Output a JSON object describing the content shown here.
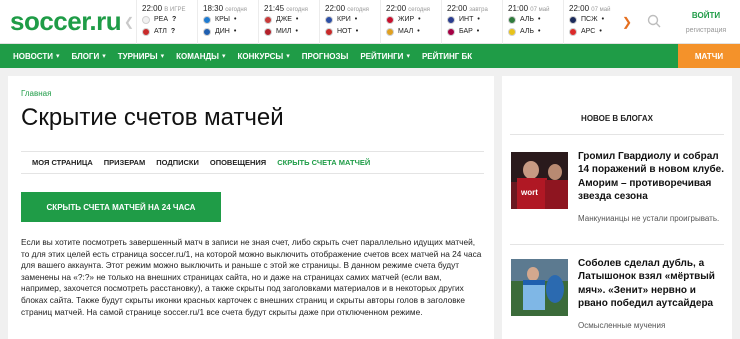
{
  "header": {
    "logo": "soccer.ru",
    "login_label": "ВОЙТИ",
    "register_label": "регистрация"
  },
  "matches": [
    {
      "time": "22:00",
      "day": "В ИГРЕ",
      "home": "РЕА",
      "home_score": "?",
      "away": "АТЛ",
      "away_score": "?",
      "home_color": "#f1f1f1",
      "away_color": "#c92a2a"
    },
    {
      "time": "18:30",
      "day": "сегодня",
      "home": "КРЫ",
      "home_score": "•",
      "away": "ДИН",
      "away_score": "•",
      "home_color": "#1f7bd1",
      "away_color": "#1f5fb0"
    },
    {
      "time": "21:45",
      "day": "сегодня",
      "home": "ДЖЕ",
      "home_score": "•",
      "away": "МИЛ",
      "away_score": "•",
      "home_color": "#c83a3a",
      "away_color": "#b3202a"
    },
    {
      "time": "22:00",
      "day": "сегодня",
      "home": "КРИ",
      "home_score": "•",
      "away": "НОТ",
      "away_score": "•",
      "home_color": "#2c4fa6",
      "away_color": "#c82a2a"
    },
    {
      "time": "22:00",
      "day": "сегодня",
      "home": "ЖИР",
      "home_score": "•",
      "away": "МАЛ",
      "away_score": "•",
      "home_color": "#c8102e",
      "away_color": "#e0a020"
    },
    {
      "time": "22:00",
      "day": "завтра",
      "home": "ИНТ",
      "home_score": "•",
      "away": "БАР",
      "away_score": "•",
      "home_color": "#2a3d8f",
      "away_color": "#a50044"
    },
    {
      "time": "21:00",
      "day": "07 май",
      "home": "АЛЬ",
      "home_score": "•",
      "away": "АЛЬ",
      "away_score": "•",
      "home_color": "#2f7a3c",
      "away_color": "#e8c31a"
    },
    {
      "time": "22:00",
      "day": "07 май",
      "home": "ПСЖ",
      "home_score": "•",
      "away": "АРС",
      "away_score": "•",
      "home_color": "#1b2a5a",
      "away_color": "#db2a2a"
    }
  ],
  "menu": [
    {
      "label": "НОВОСТИ",
      "chevron": true
    },
    {
      "label": "БЛОГИ",
      "chevron": true
    },
    {
      "label": "ТУРНИРЫ",
      "chevron": true
    },
    {
      "label": "КОМАНДЫ",
      "chevron": true
    },
    {
      "label": "КОНКУРСЫ",
      "chevron": true
    },
    {
      "label": "ПРОГНОЗЫ",
      "chevron": false
    },
    {
      "label": "РЕЙТИНГИ",
      "chevron": true
    },
    {
      "label": "РЕЙТИНГ БК",
      "chevron": false
    }
  ],
  "matches_button": "МАТЧИ",
  "main": {
    "breadcrumb": "Главная",
    "title": "Скрытие счетов матчей",
    "tabs": [
      {
        "label": "МОЯ СТРАНИЦА",
        "active": false
      },
      {
        "label": "ПРИЗЕРАМ",
        "active": false
      },
      {
        "label": "ПОДПИСКИ",
        "active": false
      },
      {
        "label": "ОПОВЕЩЕНИЯ",
        "active": false
      },
      {
        "label": "СКРЫТЬ СЧЕТА МАТЧЕЙ",
        "active": true
      }
    ],
    "hide_button": "СКРЫТЬ СЧЕТА МАТЧЕЙ НА 24 ЧАСА",
    "body": "Если вы хотите посмотреть завершенный матч в записи не зная счет, либо скрыть счет параллельно идущих матчей, то для этих целей есть страница soccer.ru/1, на которой можно выключить отображение счетов всех матчей на 24 часа для вашего аккаунта. Этот режим можно выключить и раньше с этой же страницы. В данном режиме счета будут заменены на «?:?» не только на внешних страницах сайта, но и даже на страницах самих матчей (если вам, например, захочется посмотреть расстановку), а также скрыты под заголовками материалов и в некоторых других блоках сайта. Также будут скрыты иконки красных карточек с внешних страниц и скрыты авторы голов в заголовке страниц матчей. На самой странице soccer.ru/1 все счета будут скрыты даже при отключенном режиме."
  },
  "aside": {
    "heading": "НОВОЕ В БЛОГАХ",
    "posts": [
      {
        "title": "Громил Гвардиолу и собрал 14 поражений в новом клубе. Аморим – противоречивая звезда сезона",
        "subtitle": "Манкунианцы не устали проигрывать."
      },
      {
        "title": "Соболев сделал дубль, а Латышонок взял «мёртвый мяч». «Зенит» нервно и рвано победил аутсайдера",
        "subtitle": "Осмысленные мучения"
      }
    ]
  }
}
